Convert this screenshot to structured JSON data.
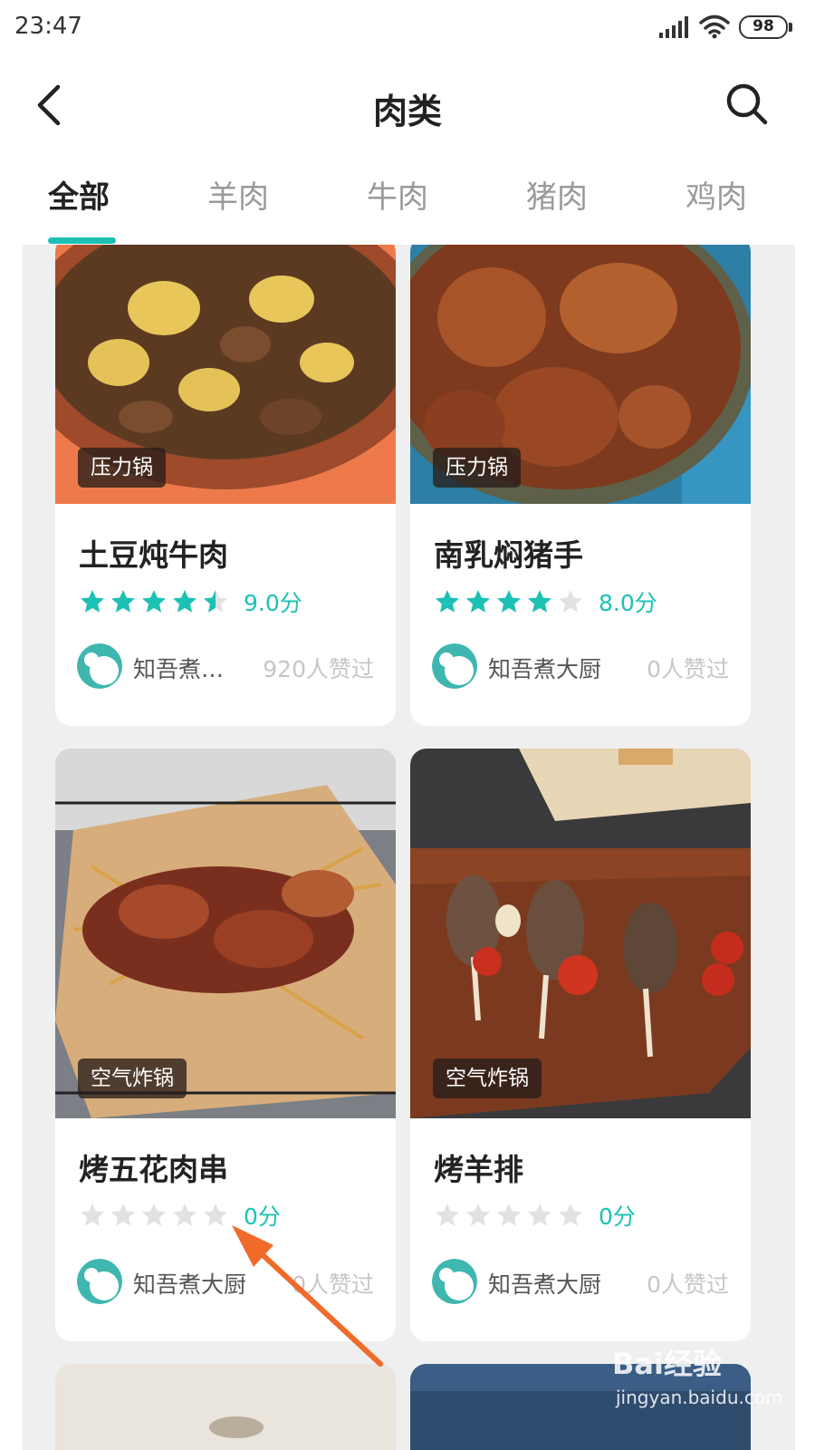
{
  "status_bar": {
    "time": "23:47",
    "battery": "98"
  },
  "header": {
    "title": "肉类"
  },
  "tabs": [
    {
      "label": "全部",
      "active": true
    },
    {
      "label": "羊肉",
      "active": false
    },
    {
      "label": "牛肉",
      "active": false
    },
    {
      "label": "猪肉",
      "active": false
    },
    {
      "label": "鸡肉",
      "active": false
    }
  ],
  "accent_color": "#1cc1b4",
  "cards": [
    {
      "tag": "压力锅",
      "title": "土豆炖牛肉",
      "rating": 4.5,
      "score": "9.0分",
      "author": "知吾煮…",
      "likes": "920人赞过"
    },
    {
      "tag": "压力锅",
      "title": "南乳焖猪手",
      "rating": 4,
      "score": "8.0分",
      "author": "知吾煮大厨",
      "likes": "0人赞过"
    },
    {
      "tag": "空气炸锅",
      "title": "烤五花肉串",
      "rating": 0,
      "score": "0分",
      "author": "知吾煮大厨",
      "likes": "0人赞过"
    },
    {
      "tag": "空气炸锅",
      "title": "烤羊排",
      "rating": 0,
      "score": "0分",
      "author": "知吾煮大厨",
      "likes": "0人赞过"
    }
  ],
  "watermark": {
    "main": "Bai经验",
    "sub": "jingyan.baidu.com"
  }
}
